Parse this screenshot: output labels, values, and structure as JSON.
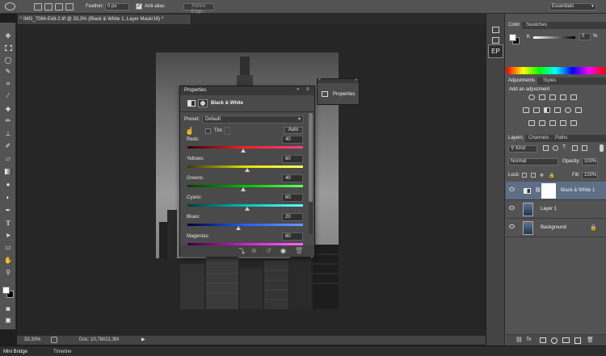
{
  "options_bar": {
    "feather_label": "Feather:",
    "feather_value": "0 px",
    "antialias_label": "Anti-alias",
    "refine_edge_label": "Refine Edge...",
    "workspace_value": "Essentials"
  },
  "document": {
    "tab_title": "IMG_7084-Edit-2.tif @ 33,3% (Black & White 1, Layer Mask/16) *"
  },
  "status": {
    "zoom": "33,33%",
    "doc_size": "Doc: 10,7M/21,3M"
  },
  "bottom_tabs": [
    "Mini Bridge",
    "Timeline"
  ],
  "side_dock": {
    "ep_label": "EP"
  },
  "properties": {
    "title": "Properties",
    "adjustment_name": "Black & White",
    "preset_label": "Preset:",
    "preset_value": "Default",
    "tint_label": "Tint",
    "auto_label": "Auto",
    "sliders": [
      {
        "label": "Reds:",
        "value": 40,
        "from": "#3a0000",
        "mid": "#ff2020",
        "to": "#ff3c8c"
      },
      {
        "label": "Yellows:",
        "value": 60,
        "from": "#3a3a00",
        "mid": "#e0e000",
        "to": "#ffff66"
      },
      {
        "label": "Greens:",
        "value": 40,
        "from": "#003a00",
        "mid": "#00c000",
        "to": "#66ff66"
      },
      {
        "label": "Cyans:",
        "value": 60,
        "from": "#003a3a",
        "mid": "#00c0c0",
        "to": "#66ffff"
      },
      {
        "label": "Blues:",
        "value": 20,
        "from": "#00003a",
        "mid": "#2060ff",
        "to": "#6699ff"
      },
      {
        "label": "Magentas:",
        "value": 80,
        "from": "#3a003a",
        "mid": "#d020d0",
        "to": "#ff66ff"
      }
    ]
  },
  "mini_panel": {
    "label": "Properties"
  },
  "color_panel": {
    "tabs": [
      "Color",
      "Swatches"
    ],
    "channel_label": "K",
    "channel_value": "0",
    "channel_unit": "%"
  },
  "adjustments_panel": {
    "tabs": [
      "Adjustments",
      "Styles"
    ],
    "heading": "Add an adjustment"
  },
  "layers_panel": {
    "tabs": [
      "Layers",
      "Channels",
      "Paths"
    ],
    "filter_label": "Kind",
    "blend_mode": "Normal",
    "opacity_label": "Opacity:",
    "opacity_value": "100%",
    "lock_label": "Lock:",
    "fill_label": "Fill:",
    "fill_value": "100%",
    "layers": [
      {
        "name": "Black & White 1",
        "selected": true
      },
      {
        "name": "Layer 1",
        "selected": false
      },
      {
        "name": "Background",
        "selected": false
      }
    ]
  },
  "icons": {
    "lasso": "lasso-icon",
    "eye": "eye-icon",
    "lock": "lock-icon",
    "hand": "hand-icon"
  }
}
